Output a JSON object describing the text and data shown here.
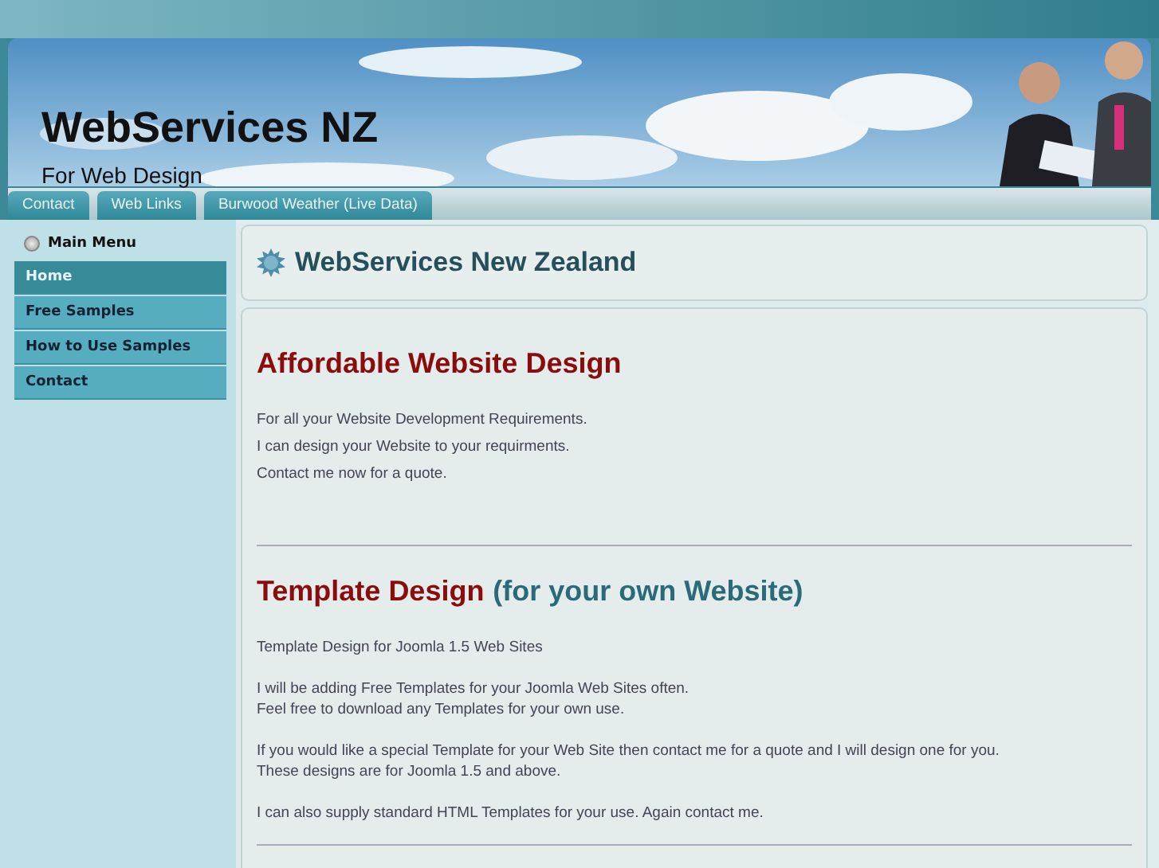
{
  "header": {
    "title": "WebServices NZ",
    "subtitle": "For Web Design"
  },
  "tabs": [
    {
      "label": "Contact"
    },
    {
      "label": "Web Links"
    },
    {
      "label": "Burwood Weather (Live Data)"
    }
  ],
  "sidebar": {
    "title": "Main Menu",
    "items": [
      {
        "label": "Home",
        "selected": true
      },
      {
        "label": "Free Samples",
        "selected": false
      },
      {
        "label": "How to Use Samples",
        "selected": false
      },
      {
        "label": "Contact",
        "selected": false
      }
    ]
  },
  "page_title": "WebServices New Zealand",
  "articles": [
    {
      "heading": "Affordable Website Design",
      "paragraphs": [
        [
          "For all your Website Development Requirements."
        ],
        [
          "I can design your Website to your requirments."
        ],
        [
          "Contact me now for a quote."
        ]
      ],
      "spaced": false
    },
    {
      "heading": "Template Design",
      "heading_aside": "(for your own Website)",
      "paragraphs": [
        [
          "Template Design for Joomla 1.5 Web Sites"
        ],
        [
          "I will be adding Free Templates for your Joomla Web Sites often.",
          "Feel free to download any Templates for your own use."
        ],
        [
          "If you would like a special Template for your Web Site then contact me for a quote and I will design one for you.",
          "These designs are for Joomla 1.5 and above."
        ],
        [
          "I can also supply standard HTML Templates for your use. Again contact me."
        ]
      ],
      "spaced": true
    }
  ]
}
